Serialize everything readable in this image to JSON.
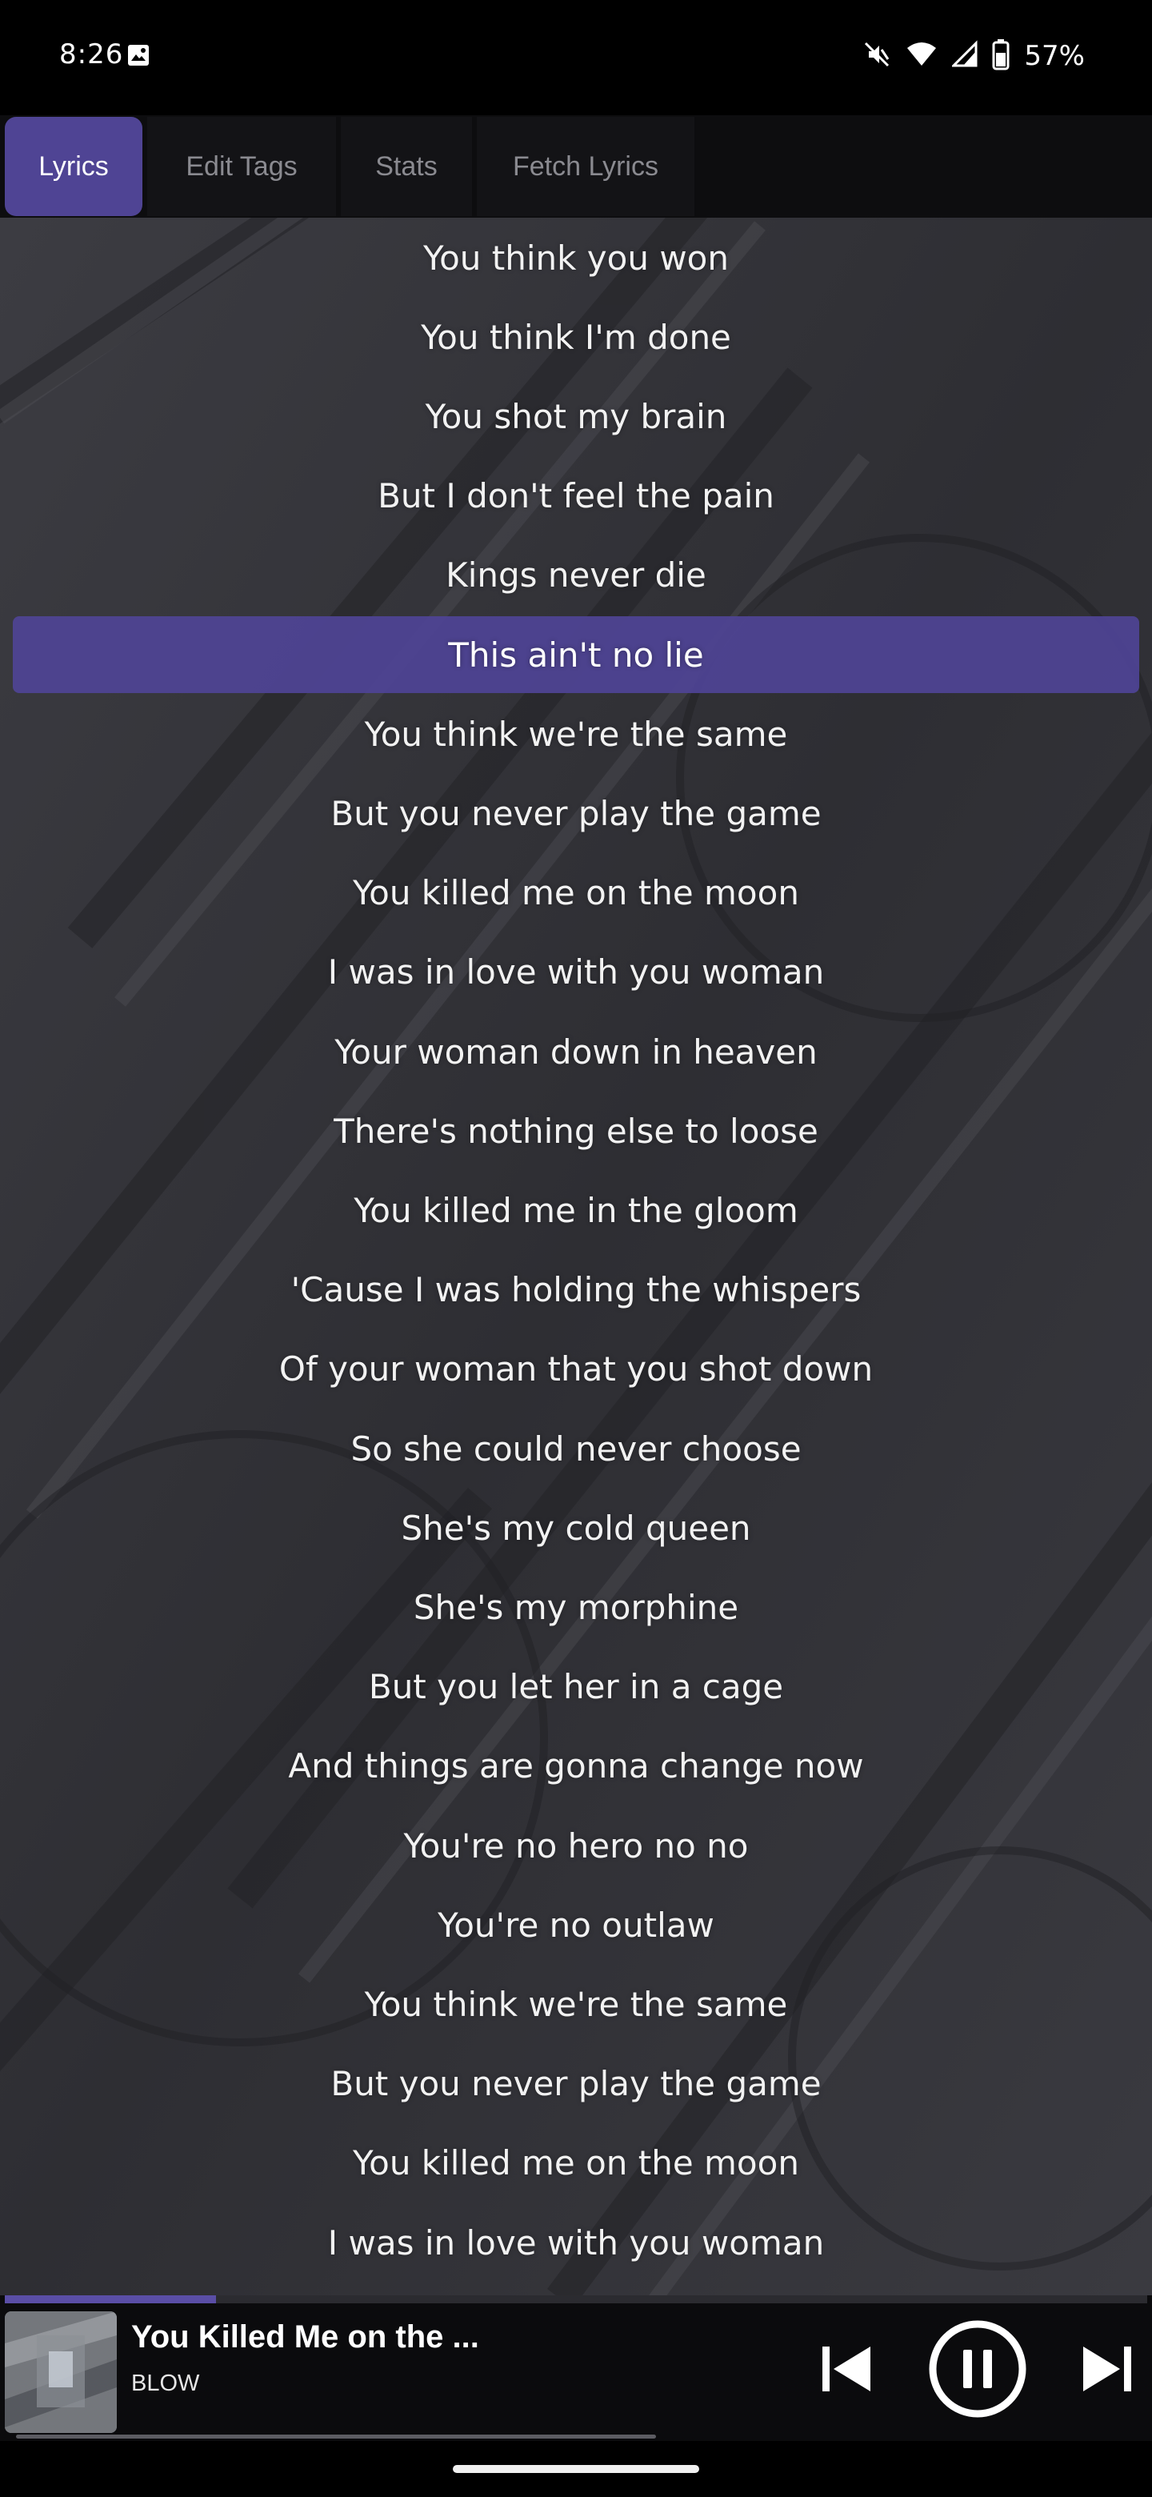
{
  "status_bar": {
    "time": "8:26",
    "battery_percent": "57%",
    "icons": [
      "gallery-notification-icon",
      "mute-icon",
      "wifi-icon",
      "signal-icon",
      "battery-icon"
    ]
  },
  "tabs": [
    {
      "label": "Lyrics",
      "active": true
    },
    {
      "label": "Edit Tags",
      "active": false
    },
    {
      "label": "Stats",
      "active": false
    },
    {
      "label": "Fetch Lyrics",
      "active": false
    }
  ],
  "lyrics": {
    "active_index": 5,
    "lines": [
      "You think you won",
      "You think I'm done",
      "You shot my brain",
      "But I don't feel the pain",
      "Kings never die",
      "This ain't no lie",
      "You think we're the same",
      "But you never play the game",
      "You killed me on the moon",
      "I was in love with you woman",
      "Your woman down in heaven",
      "There's nothing else to loose",
      "You killed me in the gloom",
      "'Cause I was holding the whispers",
      "Of your woman that you shot down",
      "So she could never choose",
      "She's my cold queen",
      "She's my morphine",
      "But you let her in a cage",
      "And things are gonna change now",
      "You're no hero no no",
      "You're no outlaw",
      "You think we're the same",
      "But you never play the game",
      "You killed me on the moon",
      "I was in love with you woman"
    ]
  },
  "player": {
    "title": "You Killed Me on the ...",
    "artist": "BLOW",
    "progress_fraction": 0.185,
    "accent_color": "#4f4494",
    "controls": [
      "skip-previous-icon",
      "pause-icon",
      "skip-next-icon"
    ]
  },
  "colors": {
    "accent": "#4f4494",
    "background": "#000000",
    "tab_inactive_text": "#8a8a90",
    "lyric_text": "#f2f2f2"
  }
}
